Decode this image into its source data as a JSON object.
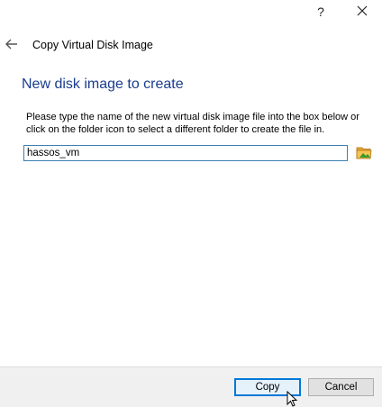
{
  "titlebar": {
    "help_label": "?",
    "close_icon": "close-icon"
  },
  "header": {
    "back_icon": "arrow-left-icon",
    "title": "Copy Virtual Disk Image"
  },
  "main": {
    "section_title": "New disk image to create",
    "description": "Please type the name of the new virtual disk image file into the box below or click on the folder icon to select a different folder to create the file in.",
    "file_name_value": "hassos_vm",
    "folder_icon": "folder-icon"
  },
  "footer": {
    "copy_label": "Copy",
    "cancel_label": "Cancel"
  },
  "colors": {
    "section_title": "#1a3c8f",
    "input_border": "#3c7fb1",
    "default_button_border": "#0078d7",
    "footer_bg": "#f0f0f0"
  }
}
